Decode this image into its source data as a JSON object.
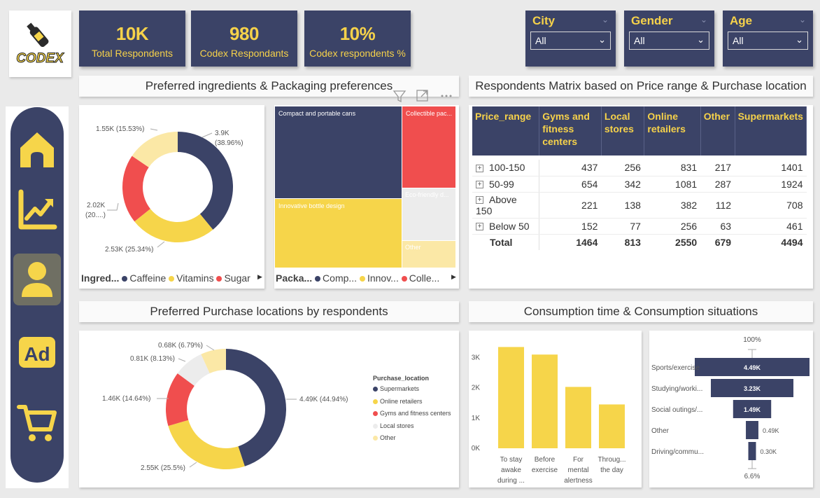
{
  "logo": {
    "text": "CODEX"
  },
  "kpis": [
    {
      "value": "10K",
      "label": "Total Respondents"
    },
    {
      "value": "980",
      "label": "Codex Respondants"
    },
    {
      "value": "10%",
      "label": "Codex respondents %"
    }
  ],
  "slicers": [
    {
      "title": "City",
      "value": "All"
    },
    {
      "title": "Gender",
      "value": "All"
    },
    {
      "title": "Age",
      "value": "All"
    }
  ],
  "nav": [
    "home-icon",
    "trend-chart-icon",
    "user-icon",
    "ad-icon",
    "cart-icon"
  ],
  "panels": {
    "ingredients_title": "Preferred ingredients & Packaging preferences",
    "matrix_title": "Respondents Matrix based on Price range & Purchase location",
    "purchase_title": "Preferred Purchase locations by respondents",
    "consumption_title": "Consumption time & Consumption situations"
  },
  "colors": {
    "navy": "#3b4367",
    "yellow": "#f6d54a",
    "red": "#f04e4e",
    "lightgray": "#ececec",
    "paleyellow": "#fbe8a6"
  },
  "ingredients_donut": {
    "legend_title": "Ingred...",
    "legend": [
      "Caffeine",
      "Vitamins",
      "Sugar"
    ],
    "labels": {
      "caffeine_a": "3.9K",
      "caffeine_b": "(38.96%)",
      "vitamins": "2.53K (25.34%)",
      "sugar_a": "2.02K",
      "sugar_b": "(20....)",
      "other": "1.55K (15.53%)"
    }
  },
  "packaging_treemap": {
    "legend_title": "Packa...",
    "legend": [
      "Comp...",
      "Innov...",
      "Colle..."
    ],
    "tiles": {
      "compact": "Compact and portable cans",
      "collectible": "Collectible pac...",
      "innovative": "Innovative bottle design",
      "eco": "Eco-friendly d...",
      "other": "Other"
    }
  },
  "matrix": {
    "headers": [
      "Price_range",
      "Gyms and fitness centers",
      "Local stores",
      "Online retailers",
      "Other",
      "Supermarkets"
    ],
    "header_lines": [
      [
        "Price_range"
      ],
      [
        "Gyms and",
        "fitness",
        "centers"
      ],
      [
        "Local",
        "stores"
      ],
      [
        "Online",
        "retailers"
      ],
      [
        "Other"
      ],
      [
        "Supermarkets"
      ]
    ],
    "rows": [
      {
        "label": "100-150",
        "values": [
          "437",
          "256",
          "831",
          "217",
          "1401"
        ]
      },
      {
        "label": "50-99",
        "values": [
          "654",
          "342",
          "1081",
          "287",
          "1924"
        ]
      },
      {
        "label": "Above 150",
        "values": [
          "221",
          "138",
          "382",
          "112",
          "708"
        ]
      },
      {
        "label": "Below 50",
        "values": [
          "152",
          "77",
          "256",
          "63",
          "461"
        ]
      }
    ],
    "total": {
      "label": "Total",
      "values": [
        "1464",
        "813",
        "2550",
        "679",
        "4494"
      ]
    }
  },
  "purchase_donut": {
    "legend_title": "Purchase_location",
    "legend": [
      "Supermarkets",
      "Online retailers",
      "Gyms and fitness centers",
      "Local stores",
      "Other"
    ],
    "labels": {
      "supermarkets": "4.49K (44.94%)",
      "online": "2.55K (25.5%)",
      "gyms": "1.46K (14.64%)",
      "local": "0.81K (8.13%)",
      "other": "0.68K (6.79%)"
    }
  },
  "chart_data": [
    {
      "type": "pie",
      "categories": [
        "Caffeine",
        "Vitamins",
        "Sugar",
        "Other"
      ],
      "values": [
        3.9,
        2.53,
        2.02,
        1.55
      ],
      "unit": "K"
    },
    {
      "type": "pie",
      "categories": [
        "Supermarkets",
        "Online retailers",
        "Gyms and fitness centers",
        "Local stores",
        "Other"
      ],
      "values": [
        4.49,
        2.55,
        1.46,
        0.81,
        0.68
      ],
      "unit": "K"
    },
    {
      "type": "bar",
      "categories": [
        "To stay awake during ...",
        "Before exercise",
        "For mental alertness",
        "Throughout the day"
      ],
      "category_lines": [
        [
          "To stay",
          "awake",
          "during ..."
        ],
        [
          "Before",
          "exercise"
        ],
        [
          "For",
          "mental",
          "alertness"
        ],
        [
          "Throug...",
          "the day"
        ]
      ],
      "values": [
        3350,
        3100,
        2030,
        1450
      ],
      "yticks": [
        "0K",
        "1K",
        "2K",
        "3K"
      ],
      "ylim": [
        0,
        3800
      ]
    },
    {
      "type": "bar",
      "orientation": "funnel",
      "categories": [
        "Sports/exercise",
        "Studying/worki...",
        "Social outings/...",
        "Other",
        "Driving/commu..."
      ],
      "values": [
        4.49,
        3.23,
        1.49,
        0.49,
        0.3
      ],
      "value_labels": [
        "4.49K",
        "3.23K",
        "1.49K",
        "0.49K",
        "0.30K"
      ],
      "top_label": "100%",
      "bottom_label": "6.6%"
    }
  ]
}
